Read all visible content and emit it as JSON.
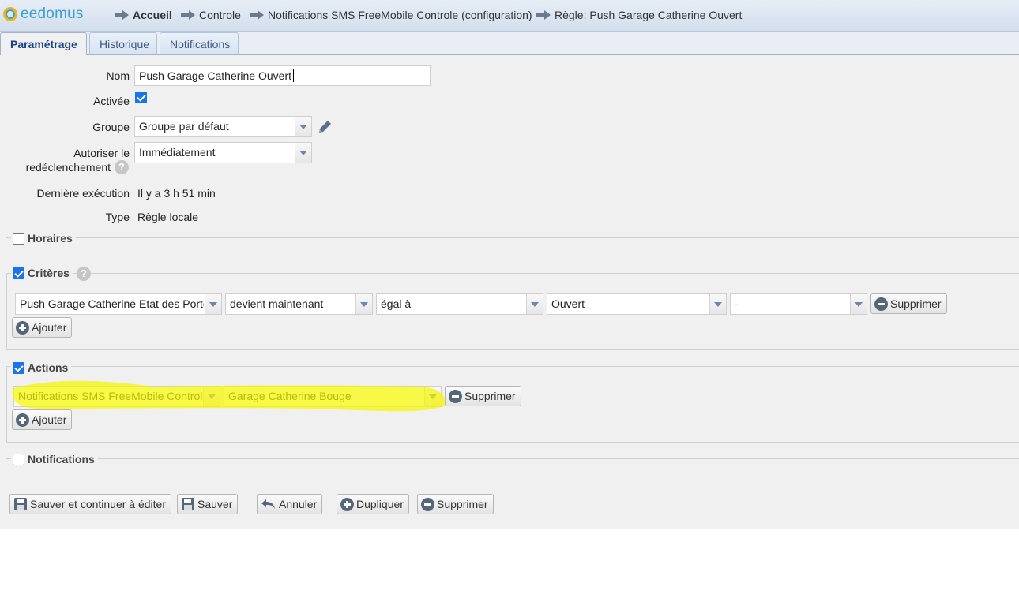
{
  "app": {
    "logo_text": "eedomus"
  },
  "breadcrumb": [
    "Accueil",
    "Controle",
    "Notifications SMS FreeMobile Controle (configuration)",
    "Règle: Push Garage Catherine Ouvert"
  ],
  "tabs": [
    "Paramétrage",
    "Historique",
    "Notifications"
  ],
  "form": {
    "nom_label": "Nom",
    "nom_value": "Push Garage Catherine Ouvert",
    "activee_label": "Activée",
    "groupe_label": "Groupe",
    "groupe_value": "Groupe par défaut",
    "autoriser_label_1": "Autoriser le",
    "autoriser_label_2": "redéclenchement",
    "autoriser_value": "Immédiatement",
    "derniere_label": "Dernière exécution",
    "derniere_value": "Il y a 3 h 51 min",
    "type_label": "Type",
    "type_value": "Règle locale"
  },
  "horaires": {
    "legend": "Horaires"
  },
  "criteres": {
    "legend": "Critères",
    "row": [
      "Push Garage Catherine Etat des Portes",
      "devient maintenant",
      "égal à",
      "Ouvert",
      "-"
    ],
    "delete_label": "Supprimer",
    "add_label": "Ajouter"
  },
  "actions": {
    "legend": "Actions",
    "row": [
      "Notifications SMS FreeMobile Controle",
      "Garage Catherine Bouge"
    ],
    "delete_label": "Supprimer",
    "add_label": "Ajouter"
  },
  "notifications": {
    "legend": "Notifications"
  },
  "footer": {
    "save_continue": "Sauver et continuer à éditer",
    "save": "Sauver",
    "cancel": "Annuler",
    "duplicate": "Dupliquer",
    "delete": "Supprimer"
  },
  "colors": {
    "accent": "#1a73e8",
    "highlight": "#f5f500",
    "header": "#d3dfed"
  }
}
